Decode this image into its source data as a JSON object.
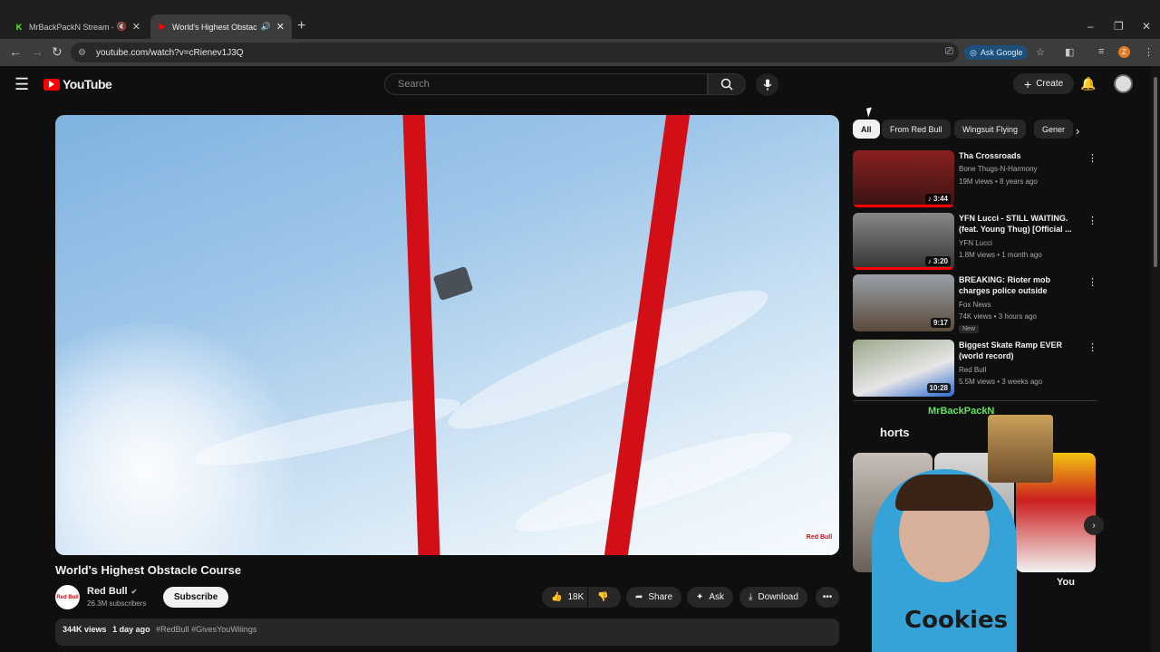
{
  "browser": {
    "tabs": [
      {
        "label": "MrBackPackN Stream - Wa",
        "favicon": "K",
        "accent": "#53fc18",
        "muted": true
      },
      {
        "label": "World's Highest Obstacle C",
        "favicon": "▶",
        "accent": "#ff0000",
        "audio": true
      }
    ],
    "url": "youtube.com/watch?v=cRienev1J3Q",
    "ask_google": "Ask Google",
    "profile_initial": "Z"
  },
  "header": {
    "logo_text": "YouTube",
    "search_placeholder": "Search",
    "create_label": "Create"
  },
  "video": {
    "title": "World's Highest Obstacle Course",
    "channel": {
      "name": "Red Bull",
      "subscribers": "26.3M subscribers",
      "avatar_text": "Red Bull"
    },
    "subscribe_label": "Subscribe",
    "likes": "18K",
    "share_label": "Share",
    "ask_label": "Ask",
    "download_label": "Download",
    "views": "344K views",
    "age": "1 day ago",
    "tags": "#RedBull #GivesYouWiiings",
    "watermark": "Red Bull"
  },
  "chips": [
    "All",
    "From Red Bull",
    "Wingsuit Flying",
    "Gener"
  ],
  "recommendations": [
    {
      "title": "Tha Crossroads",
      "channel": "Bone Thugs-N-Harmony",
      "meta": "19M views • 8 years ago",
      "duration": "♪ 3:44",
      "thumb_color": "#5a1d1d",
      "progress": 1.0
    },
    {
      "title": "YFN Lucci - STILL WAITING. (feat. Young Thug) [Official ...",
      "channel": "YFN Lucci",
      "meta": "1.8M views • 1 month ago",
      "duration": "♪ 3:20",
      "thumb_color": "#555555",
      "progress": 1.0
    },
    {
      "title": "BREAKING: Rioter mob charges police outside Chicago-area IC...",
      "channel": "Fox News",
      "meta": "74K views • 3 hours ago",
      "duration": "9:17",
      "thumb_color": "#6a5a4a",
      "badge": "New",
      "progress": 0
    },
    {
      "title": "Biggest Skate Ramp EVER (world record)",
      "channel": "Red Bull",
      "meta": "5.5M views • 3 weeks ago",
      "duration": "10:28",
      "thumb_color": "#7a8a6a",
      "progress": 0
    }
  ],
  "shorts": {
    "label": "horts",
    "caption": "You"
  },
  "overlay_text": "MrBackPackN"
}
